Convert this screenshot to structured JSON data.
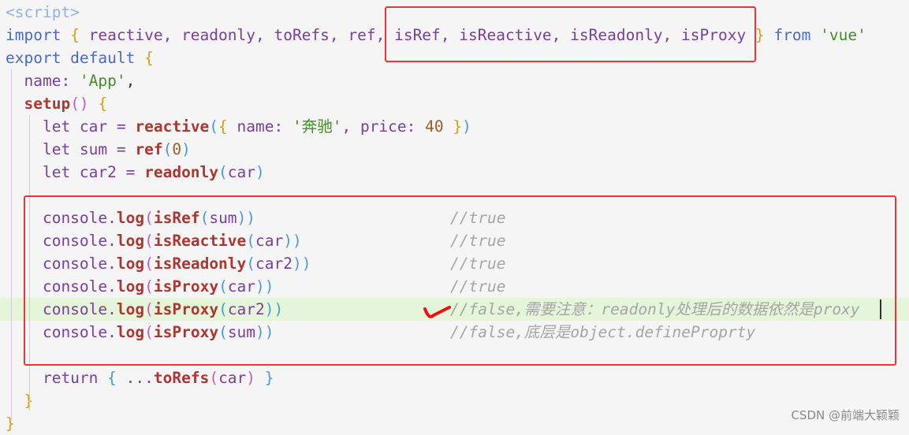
{
  "editor": {
    "colors": {
      "highlight_line": "#e5f5d9",
      "annotation_red": "#f03434",
      "background": "#f5f5f5"
    },
    "lines": [
      {
        "tokens": [
          [
            "<script>",
            "tag"
          ]
        ]
      },
      {
        "tokens": [
          [
            "import ",
            "kw"
          ],
          [
            "{ ",
            "br"
          ],
          [
            "reactive, readonly, toRefs, ref, isRef, isReactive, isReadonly, isProxy ",
            "id"
          ],
          [
            "} ",
            "br"
          ],
          [
            "from ",
            "kw"
          ],
          [
            "'vue'",
            "str"
          ]
        ]
      },
      {
        "tokens": [
          [
            "export default ",
            "kw"
          ],
          [
            "{",
            "br"
          ]
        ]
      },
      {
        "tokens": [
          [
            "  name: ",
            "id"
          ],
          [
            "'App'",
            "str"
          ],
          [
            ",",
            "pl"
          ]
        ]
      },
      {
        "tokens": [
          [
            "  ",
            "pl"
          ],
          [
            "setup",
            "fn"
          ],
          [
            "() ",
            "pa"
          ],
          [
            "{",
            "br"
          ]
        ]
      },
      {
        "tokens": [
          [
            "    let car = ",
            "id"
          ],
          [
            "reactive",
            "fn"
          ],
          [
            "(",
            "cb"
          ],
          [
            "{ ",
            "br"
          ],
          [
            "name: ",
            "id"
          ],
          [
            "'奔驰'",
            "str"
          ],
          [
            ", price: ",
            "id"
          ],
          [
            "40 ",
            "num"
          ],
          [
            "}",
            "br"
          ],
          [
            ")",
            "cb"
          ]
        ]
      },
      {
        "tokens": [
          [
            "    let sum = ",
            "id"
          ],
          [
            "ref",
            "fn"
          ],
          [
            "(",
            "cb"
          ],
          [
            "0",
            "num"
          ],
          [
            ")",
            "cb"
          ]
        ]
      },
      {
        "tokens": [
          [
            "    let car2 = ",
            "id"
          ],
          [
            "readonly",
            "fn"
          ],
          [
            "(",
            "cb"
          ],
          [
            "car",
            "id"
          ],
          [
            ")",
            "cb"
          ]
        ]
      },
      {
        "tokens": []
      },
      {
        "tokens": [
          [
            "    console.",
            "id"
          ],
          [
            "log",
            "fn"
          ],
          [
            "(",
            "pa"
          ],
          [
            "isRef",
            "fn"
          ],
          [
            "(",
            "cb"
          ],
          [
            "sum",
            "id"
          ],
          [
            "))",
            "cb"
          ]
        ],
        "comment": "//true"
      },
      {
        "tokens": [
          [
            "    console.",
            "id"
          ],
          [
            "log",
            "fn"
          ],
          [
            "(",
            "pa"
          ],
          [
            "isReactive",
            "fn"
          ],
          [
            "(",
            "cb"
          ],
          [
            "car",
            "id"
          ],
          [
            "))",
            "cb"
          ]
        ],
        "comment": "//true"
      },
      {
        "tokens": [
          [
            "    console.",
            "id"
          ],
          [
            "log",
            "fn"
          ],
          [
            "(",
            "pa"
          ],
          [
            "isReadonly",
            "fn"
          ],
          [
            "(",
            "cb"
          ],
          [
            "car2",
            "id"
          ],
          [
            "))",
            "cb"
          ]
        ],
        "comment": "//true"
      },
      {
        "tokens": [
          [
            "    console.",
            "id"
          ],
          [
            "log",
            "fn"
          ],
          [
            "(",
            "pa"
          ],
          [
            "isProxy",
            "fn"
          ],
          [
            "(",
            "cb"
          ],
          [
            "car",
            "id"
          ],
          [
            "))",
            "cb"
          ]
        ],
        "comment": "//true"
      },
      {
        "tokens": [
          [
            "    console.",
            "id"
          ],
          [
            "log",
            "fn"
          ],
          [
            "(",
            "pa"
          ],
          [
            "isProxy",
            "fn"
          ],
          [
            "(",
            "cb"
          ],
          [
            "car2",
            "id"
          ],
          [
            "))",
            "cb"
          ]
        ],
        "comment": "//false,需要注意：readonly处理后的数据依然是proxy",
        "highlight": true
      },
      {
        "tokens": [
          [
            "    console.",
            "id"
          ],
          [
            "log",
            "fn"
          ],
          [
            "(",
            "pa"
          ],
          [
            "isProxy",
            "fn"
          ],
          [
            "(",
            "cb"
          ],
          [
            "sum",
            "id"
          ],
          [
            "))",
            "cb"
          ]
        ],
        "comment": "//false,底层是object.defineProprty"
      },
      {
        "tokens": []
      },
      {
        "tokens": [
          [
            "    return ",
            "id"
          ],
          [
            "{ ",
            "cb"
          ],
          [
            "...",
            "id"
          ],
          [
            "toRefs",
            "fn"
          ],
          [
            "(",
            "pa"
          ],
          [
            "car",
            "id"
          ],
          [
            ") ",
            "pa"
          ],
          [
            "}",
            "cb"
          ]
        ]
      },
      {
        "tokens": [
          [
            "  ",
            "pl"
          ],
          [
            "}",
            "br"
          ]
        ]
      },
      {
        "tokens": [
          [
            "}",
            "br"
          ]
        ]
      }
    ]
  },
  "watermark": "CSDN @前端大颖颖"
}
